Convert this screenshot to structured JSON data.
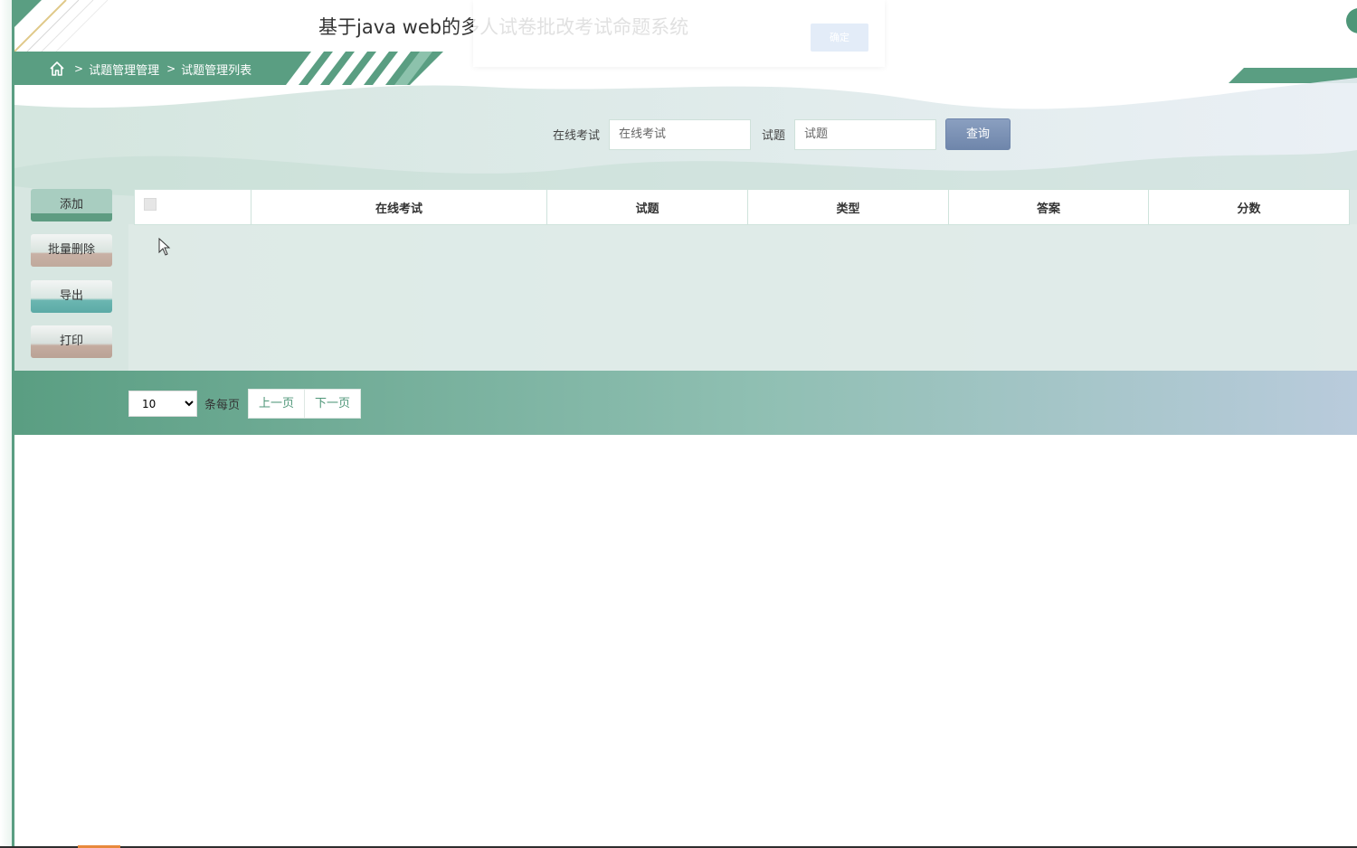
{
  "app": {
    "title": "基于java web的多人试卷批改考试命题系统"
  },
  "breadcrumb": {
    "items": [
      "试题管理管理",
      "试题管理列表"
    ],
    "separator": ">"
  },
  "search": {
    "exam_label": "在线考试",
    "exam_placeholder": "在线考试",
    "question_label": "试题",
    "question_placeholder": "试题",
    "query_button": "查询"
  },
  "actions": {
    "add": "添加",
    "batch_delete": "批量删除",
    "export": "导出",
    "print": "打印"
  },
  "table": {
    "columns": [
      "在线考试",
      "试题",
      "类型",
      "答案",
      "分数"
    ],
    "rows": []
  },
  "pagination": {
    "page_size": "10",
    "page_size_options": [
      "10"
    ],
    "per_page_label": "条每页",
    "prev": "上一页",
    "next": "下一页"
  },
  "icons": {
    "home": "home-icon",
    "cursor": "mouse-cursor-icon"
  },
  "colors": {
    "brand_green": "#5a9e82",
    "query_button": "#7a90b4",
    "link_green": "#4e9678"
  }
}
